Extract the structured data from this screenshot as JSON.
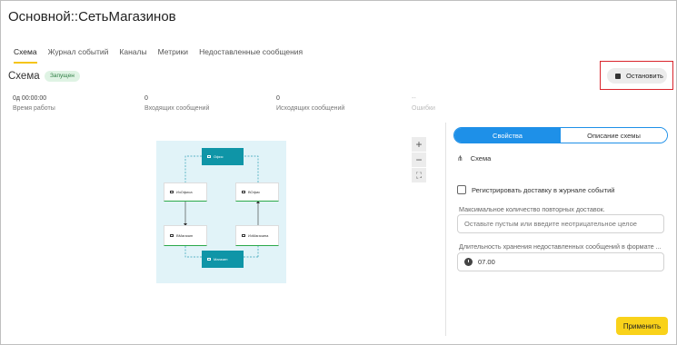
{
  "header": {
    "title": "Основной::СетьМагазинов"
  },
  "tabs": [
    {
      "label": "Схема",
      "active": true
    },
    {
      "label": "Журнал событий"
    },
    {
      "label": "Каналы"
    },
    {
      "label": "Метрики"
    },
    {
      "label": "Недоставленные сообщения"
    }
  ],
  "section": {
    "title": "Схема",
    "status": "Запущен"
  },
  "actions": {
    "stop_label": "Остановить"
  },
  "stats": [
    {
      "value": "0д 00:00:00",
      "label": "Время работы"
    },
    {
      "value": "0",
      "label": "Входящих сообщений"
    },
    {
      "value": "0",
      "label": "Исходящих сообщений"
    },
    {
      "value": "--",
      "label": "Ошибки"
    }
  ],
  "diagram": {
    "nodes": {
      "office": "Офис",
      "from_office": "ИзОфиса",
      "to_office": "ВОфис",
      "to_shop": "ВМагазин",
      "from_shop": "ИзМагазина",
      "shop": "Магазин"
    }
  },
  "zoom": {
    "plus": "+",
    "minus": "−",
    "fit": "⛶"
  },
  "panel": {
    "tabs": [
      {
        "label": "Свойства",
        "active": true
      },
      {
        "label": "Описание схемы"
      }
    ],
    "schema_label": "Схема",
    "checkbox_label": "Регистрировать доставку в журнале событий",
    "retries": {
      "label": "Максимальное количество повторных доставок.",
      "placeholder": "Оставьте пустым или введите неотрицательное целое"
    },
    "retention": {
      "label": "Длительность хранения недоставленных сообщений в формате ...",
      "value": "07.00"
    },
    "apply_label": "Применить"
  },
  "colors": {
    "accent_tab": "#f5c518",
    "primary": "#1e90e8",
    "apply": "#f9d21a",
    "stop_outline": "#d9242c",
    "node_teal": "#0f95a7"
  }
}
